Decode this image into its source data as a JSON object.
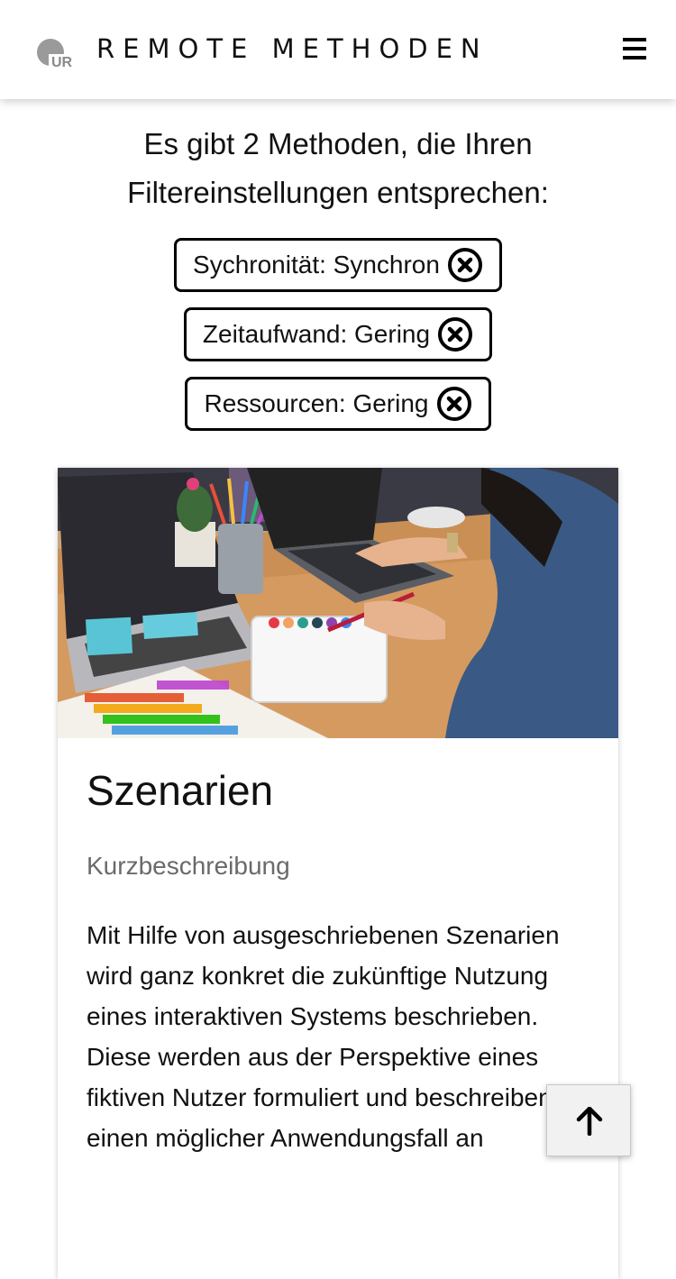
{
  "header": {
    "logo_text": "UR",
    "title": "REMOTE METHODEN",
    "menu_icon": "hamburger-menu-icon"
  },
  "results": {
    "summary": "Es gibt 2 Methoden, die Ihren Filtereinstellungen entsprechen:"
  },
  "filters": [
    {
      "label": "Sychronität: Synchron",
      "icon": "remove-circle-x-icon"
    },
    {
      "label": "Zeitaufwand: Gering",
      "icon": "remove-circle-x-icon"
    },
    {
      "label": "Ressourcen: Gering",
      "icon": "remove-circle-x-icon"
    }
  ],
  "card": {
    "image_description_icon": "photo-illustration",
    "title": "Szenarien",
    "subtitle": "Kurzbeschreibung",
    "description": "Mit Hilfe von ausgeschriebenen Szenarien wird ganz konkret die zukünftige Nutzung eines interaktiven Systems beschrieben. Diese werden aus der Perspektive eines fiktiven Nutzer formuliert und beschreiben einen möglicher Anwendungsfall an"
  },
  "scroll_top": {
    "icon": "arrow-up-icon"
  },
  "colors": {
    "text": "#111111",
    "muted": "#6a6a6a",
    "logo_gray": "#9a9a9a",
    "button_bg": "#f1f1f1"
  }
}
